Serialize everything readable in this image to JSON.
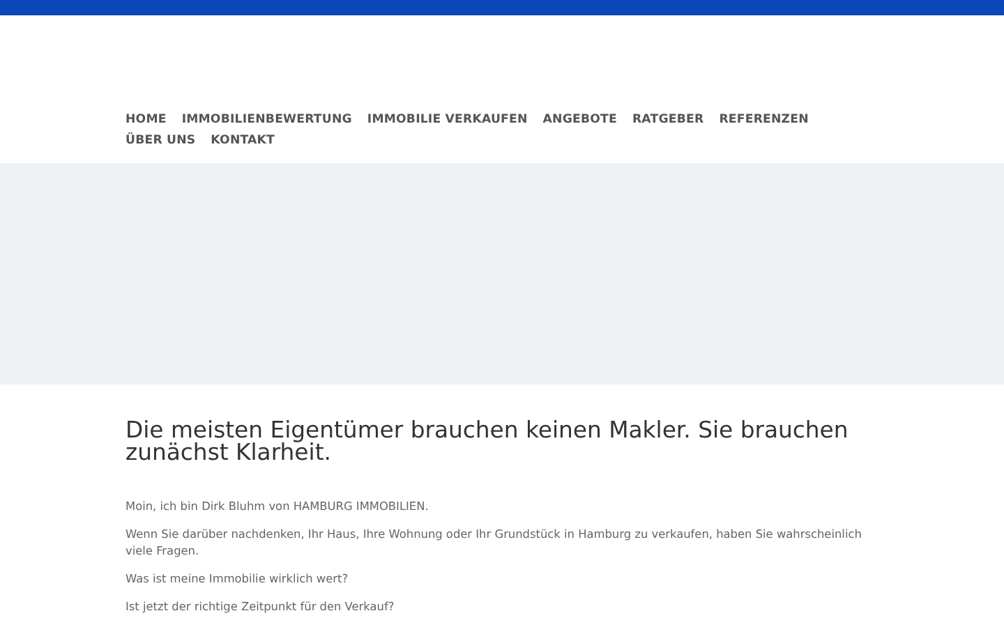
{
  "nav": {
    "items": [
      {
        "label": "HOME"
      },
      {
        "label": "IMMOBILIENBEWERTUNG"
      },
      {
        "label": "IMMOBILIE VERKAUFEN"
      },
      {
        "label": "ANGEBOTE"
      },
      {
        "label": "RATGEBER"
      },
      {
        "label": "REFERENZEN"
      },
      {
        "label": "ÜBER UNS"
      },
      {
        "label": "KONTAKT"
      }
    ]
  },
  "intro": {
    "heading": "Die meisten Eigentümer brauchen keinen Makler. Sie brauchen zunächst Klarheit.",
    "paragraphs": [
      "Moin, ich bin Dirk Bluhm von HAMBURG IMMOBILIEN.",
      "Wenn Sie darüber nachdenken, Ihr Haus, Ihre Wohnung oder Ihr Grundstück in Hamburg zu verkaufen, haben Sie wahrscheinlich viele Fragen.",
      "Was ist meine Immobilie wirklich wert?",
      "Ist jetzt der richtige Zeitpunkt für den Verkauf?"
    ]
  }
}
